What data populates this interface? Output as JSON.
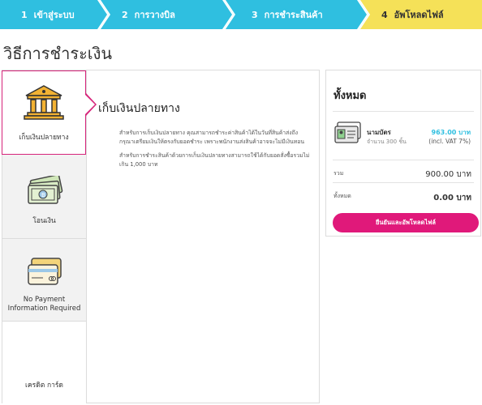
{
  "steps": [
    {
      "num": "1",
      "label": "เข้าสู่ระบบ"
    },
    {
      "num": "2",
      "label": "การวางบิล"
    },
    {
      "num": "3",
      "label": "การชำระสินค้า"
    },
    {
      "num": "4",
      "label": "อัพโหลดไฟล์"
    }
  ],
  "page_title": "วิธีการชำระเงิน",
  "methods": [
    {
      "label": "เก็บเงินปลายทาง",
      "icon": "bank-icon",
      "active": true
    },
    {
      "label": "โอนเงิน",
      "icon": "banknotes-icon",
      "active": false
    },
    {
      "label": "No Payment Information Required",
      "icon": "credit-cards-icon",
      "active": false
    },
    {
      "label": "เครดิต การ์ด",
      "icon": "",
      "active": false
    }
  ],
  "detail": {
    "title": "เก็บเงินปลายทาง",
    "paragraph1": "สำหรับการเก็บเงินปลายทาง คุณสามารถชำระค่าสินค้าได้ในวันที่สินค้าส่งถึง กรุณาเตรียมเงินให้ตรงกับยอดชำระ เพราะพนักงานส่งสินค้าอาจจะไม่มีเงินทอน",
    "paragraph2": "สำหรับการชำระสินค้าด้วยการเก็บเงินปลายทางสามารถใช้ได้กับยอดสั่งซื้อรวมไม่เกิน 1,000 บาท"
  },
  "summary": {
    "heading": "ทั้งหมด",
    "item": {
      "name": "นามบัตร",
      "qty": "จำนวน 300 ชิ้น",
      "price": "963.00 บาท",
      "vat": "(incl. VAT 7%)",
      "icon": "business-card-icon"
    },
    "subtotal_label": "รวม",
    "subtotal_value": "900.00 บาท",
    "total_label": "ทั้งหมด",
    "total_value": "0.00 บาท",
    "cta_label": "ยืนยันและอัพโหลดไฟล์"
  },
  "colors": {
    "step_active": "#2fbfe0",
    "step_current": "#f5e158",
    "accent": "#e0197a",
    "price": "#2fbfe0"
  }
}
